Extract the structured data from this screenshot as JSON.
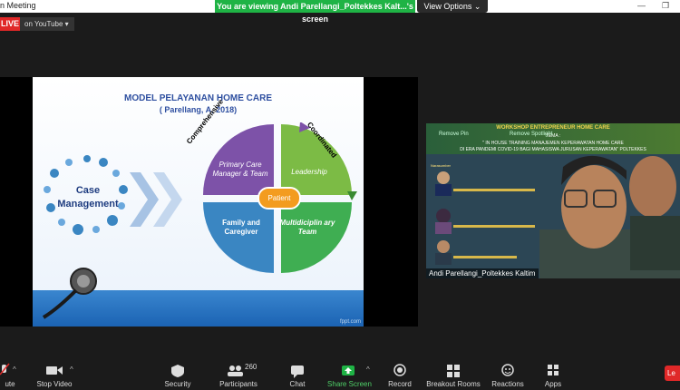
{
  "window": {
    "title": "n Meeting",
    "minimize_glyph": "—",
    "restore_glyph": "❐"
  },
  "share_banner": {
    "text": "You are viewing Andi Parellangi_Poltekkes Kalt...'s screen",
    "view_options": "View Options ⌄"
  },
  "live": {
    "badge": "LIVE",
    "on_youtube": "on YouTube ▾"
  },
  "slide": {
    "title": "MODEL PELAYANAN HOME CARE",
    "subtitle": "( Parellang, A, 2018)",
    "case_line1": "Case",
    "case_line2": "Management",
    "quadrants": {
      "top_left": "Primary Care Manager & Team",
      "top_right": "Leadership",
      "bottom_left": "Family and Caregiver",
      "bottom_right": "Multidiciplin ary Team"
    },
    "center": "Patient",
    "arc_left": "Comprehensive",
    "arc_right": "Coordinated",
    "watermark": "fppt.com",
    "colors": {
      "purple": "#7d52a8",
      "green": "#7cbb45",
      "blue": "#3a86c2",
      "teal": "#3fae52",
      "orange": "#f39c1f"
    }
  },
  "video": {
    "banner_line1": "WORKSHOP ENTREPRENEUR HOME CARE",
    "banner_line2": "TEMA :",
    "banner_line3": "\" IN HOUSE TRAINING MANAJEMEN KEPERAWATAN HOME CARE",
    "banner_line4": "DI ERA PANDEMI COVID-19 BAGI MAHASISWA JURUSAN KEPERAWATAN\" POLTEKKES",
    "remove_pin": "Remove Pin",
    "remove_spotlight": "Remove Spotlight",
    "narasumber": "Narasumber",
    "speaker_name": "Andi Parellangi_Poltekkes Kaltim"
  },
  "toolbar": {
    "mute": "ute",
    "stop_video": "Stop Video",
    "security": "Security",
    "participants": "Participants",
    "participants_count": "260",
    "chat": "Chat",
    "share_screen": "Share Screen",
    "record": "Record",
    "breakout_rooms": "Breakout Rooms",
    "reactions": "Reactions",
    "apps": "Apps",
    "leave": "Le"
  }
}
